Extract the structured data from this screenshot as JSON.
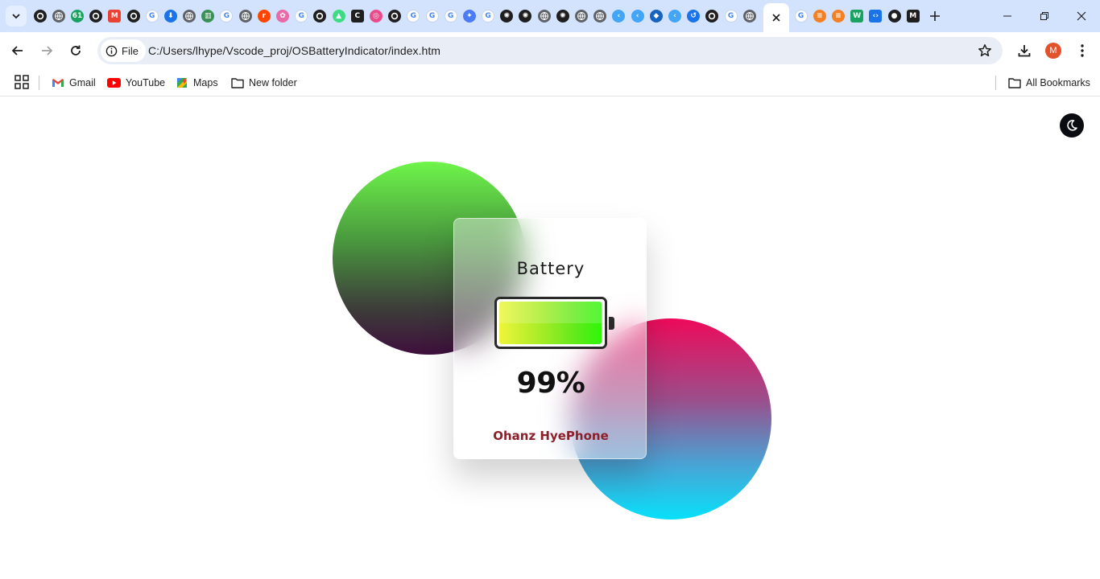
{
  "browser": {
    "tabs_favicons": [
      {
        "icon": "github-icon",
        "color": "#1f1f1f",
        "glyph": ""
      },
      {
        "icon": "globe-icon",
        "color": "#5f6368",
        "glyph": ""
      },
      {
        "icon": "counter-61-icon",
        "color": "#1aa260",
        "glyph": "61"
      },
      {
        "icon": "github-icon",
        "color": "#1f1f1f",
        "glyph": ""
      },
      {
        "icon": "gmail-icon",
        "color": "#ea4335",
        "glyph": "M"
      },
      {
        "icon": "github-icon",
        "color": "#1f1f1f",
        "glyph": ""
      },
      {
        "icon": "google-icon",
        "color": "#4285f4",
        "glyph": "G"
      },
      {
        "icon": "download-icon",
        "color": "#1a73e8",
        "glyph": "⬇"
      },
      {
        "icon": "globe-icon",
        "color": "#5f6368",
        "glyph": ""
      },
      {
        "icon": "chart-icon",
        "color": "#3c8f57",
        "glyph": "▥"
      },
      {
        "icon": "google-icon",
        "color": "#4285f4",
        "glyph": "G"
      },
      {
        "icon": "globe-icon",
        "color": "#5f6368",
        "glyph": ""
      },
      {
        "icon": "reddit-icon",
        "color": "#ff4500",
        "glyph": "r"
      },
      {
        "icon": "brain-icon",
        "color": "#e86aa6",
        "glyph": "✿"
      },
      {
        "icon": "google-icon",
        "color": "#4285f4",
        "glyph": "G"
      },
      {
        "icon": "github-icon",
        "color": "#1f1f1f",
        "glyph": ""
      },
      {
        "icon": "android-icon",
        "color": "#3ddc84",
        "glyph": "▲"
      },
      {
        "icon": "c-letter-icon",
        "color": "#1f1f1f",
        "glyph": "C"
      },
      {
        "icon": "dribbble-icon",
        "color": "#ea4c89",
        "glyph": "◎"
      },
      {
        "icon": "github-icon",
        "color": "#1f1f1f",
        "glyph": ""
      },
      {
        "icon": "google-icon",
        "color": "#4285f4",
        "glyph": "G"
      },
      {
        "icon": "google-icon",
        "color": "#4285f4",
        "glyph": "G"
      },
      {
        "icon": "google-icon",
        "color": "#4285f4",
        "glyph": "G"
      },
      {
        "icon": "gemini-icon",
        "color": "#4a7cf6",
        "glyph": "✦"
      },
      {
        "icon": "google-icon",
        "color": "#4285f4",
        "glyph": "G"
      },
      {
        "icon": "openai-icon",
        "color": "#1f1f1f",
        "glyph": "✺"
      },
      {
        "icon": "openai-icon",
        "color": "#1f1f1f",
        "glyph": "✺"
      },
      {
        "icon": "globe-search-icon",
        "color": "#5f6368",
        "glyph": ""
      },
      {
        "icon": "openai-icon",
        "color": "#1f1f1f",
        "glyph": "✺"
      },
      {
        "icon": "globe-icon",
        "color": "#5f6368",
        "glyph": ""
      },
      {
        "icon": "globe-icon",
        "color": "#5f6368",
        "glyph": ""
      },
      {
        "icon": "flutter-icon",
        "color": "#42a5f5",
        "glyph": "‹"
      },
      {
        "icon": "flutter-icon",
        "color": "#42a5f5",
        "glyph": "‹"
      },
      {
        "icon": "dart-icon",
        "color": "#1565c0",
        "glyph": "◆"
      },
      {
        "icon": "flutter-icon",
        "color": "#42a5f5",
        "glyph": "‹"
      },
      {
        "icon": "history-icon",
        "color": "#1a73e8",
        "glyph": "↺"
      },
      {
        "icon": "github-icon",
        "color": "#1f1f1f",
        "glyph": ""
      },
      {
        "icon": "google-icon",
        "color": "#4285f4",
        "glyph": "G"
      },
      {
        "icon": "globe-icon",
        "color": "#5f6368",
        "glyph": ""
      }
    ],
    "tabs_favicons_after": [
      {
        "icon": "google-icon",
        "color": "#4285f4",
        "glyph": "G"
      },
      {
        "icon": "stackoverflow-icon",
        "color": "#f48024",
        "glyph": "≡"
      },
      {
        "icon": "stackoverflow-icon",
        "color": "#f48024",
        "glyph": "≡"
      },
      {
        "icon": "w-letter-icon",
        "color": "#1aa260",
        "glyph": "W"
      },
      {
        "icon": "code-icon",
        "color": "#1a73e8",
        "glyph": "‹›"
      },
      {
        "icon": "ninja-icon",
        "color": "#1f1f1f",
        "glyph": "●"
      },
      {
        "icon": "m-letter-icon",
        "color": "#1f1f1f",
        "glyph": "M"
      }
    ],
    "url": "C:/Users/lhype/Vscode_proj/OSBatteryIndicator/index.htm",
    "site_chip_label": "File",
    "profile_initial": "M",
    "bookmarks": {
      "gmail": "Gmail",
      "youtube": "YouTube",
      "maps": "Maps",
      "new_folder": "New folder",
      "all": "All Bookmarks"
    }
  },
  "page": {
    "card_title": "Battery",
    "battery_level_fraction": 0.99,
    "percent_text": "99%",
    "device_name": "Ohanz HyePhone",
    "colors": {
      "device_name": "#8b1f2a",
      "battery_fill_start": "#eef53a",
      "battery_fill_end": "#2df708",
      "toggle_bg": "#0b0b12"
    }
  }
}
